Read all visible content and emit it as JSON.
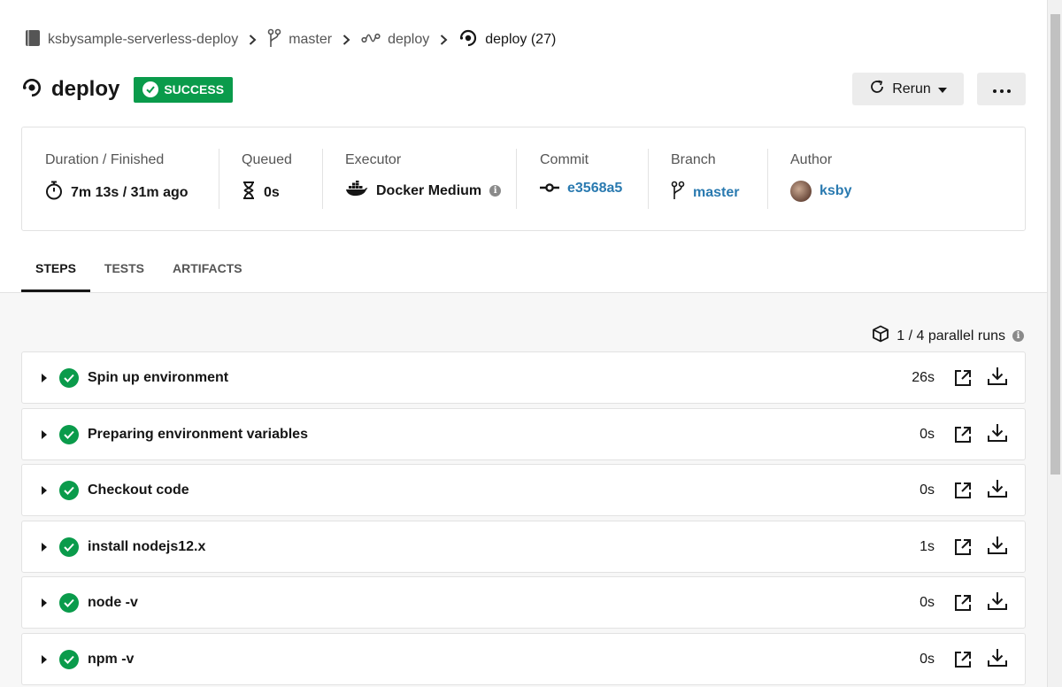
{
  "breadcrumb": {
    "project": "ksbysample-serverless-deploy",
    "branch": "master",
    "workflow": "deploy",
    "job": "deploy (27)"
  },
  "header": {
    "title": "deploy",
    "status": "SUCCESS",
    "rerun_label": "Rerun"
  },
  "info": {
    "duration_label": "Duration / Finished",
    "duration_value": "7m 13s / 31m ago",
    "queued_label": "Queued",
    "queued_value": "0s",
    "executor_label": "Executor",
    "executor_value": "Docker Medium",
    "commit_label": "Commit",
    "commit_value": "e3568a5",
    "branch_label": "Branch",
    "branch_value": "master",
    "author_label": "Author",
    "author_value": "ksby"
  },
  "tabs": [
    {
      "label": "STEPS",
      "active": true
    },
    {
      "label": "TESTS",
      "active": false
    },
    {
      "label": "ARTIFACTS",
      "active": false
    }
  ],
  "parallel_runs": "1 / 4 parallel runs",
  "steps": [
    {
      "name": "Spin up environment",
      "duration": "26s"
    },
    {
      "name": "Preparing environment variables",
      "duration": "0s"
    },
    {
      "name": "Checkout code",
      "duration": "0s"
    },
    {
      "name": "install nodejs12.x",
      "duration": "1s"
    },
    {
      "name": "node -v",
      "duration": "0s"
    },
    {
      "name": "npm -v",
      "duration": "0s"
    }
  ],
  "colors": {
    "success": "#0a9b4b",
    "link": "#2a7ab0"
  }
}
